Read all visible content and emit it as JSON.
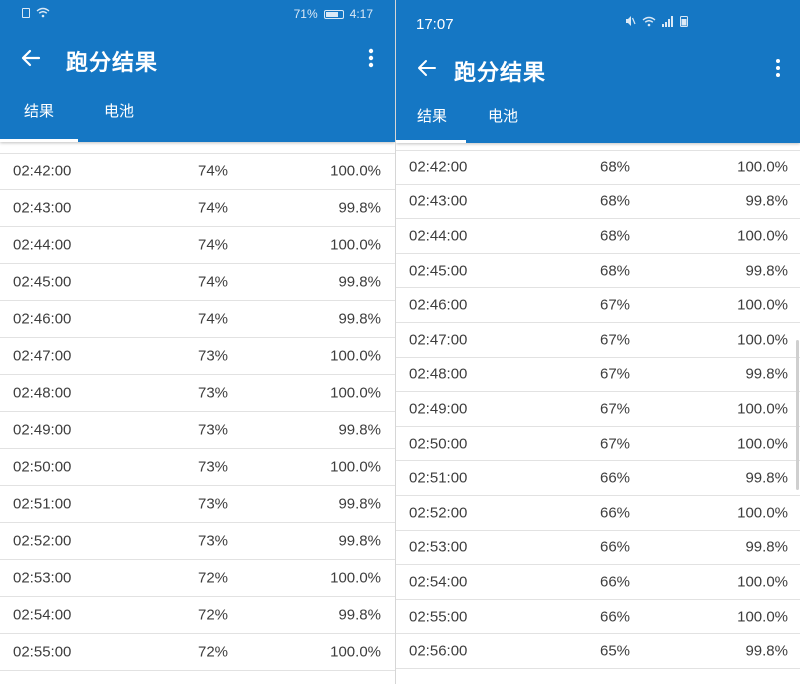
{
  "left": {
    "status": {
      "battery_percent": "71%",
      "time": "4:17"
    },
    "title": "跑分结果",
    "tabs": [
      {
        "label": "结果"
      },
      {
        "label": "电池"
      }
    ],
    "rows": [
      {
        "time": "02:42:00",
        "battery": "74%",
        "score": "100.0%"
      },
      {
        "time": "02:43:00",
        "battery": "74%",
        "score": "99.8%"
      },
      {
        "time": "02:44:00",
        "battery": "74%",
        "score": "100.0%"
      },
      {
        "time": "02:45:00",
        "battery": "74%",
        "score": "99.8%"
      },
      {
        "time": "02:46:00",
        "battery": "74%",
        "score": "99.8%"
      },
      {
        "time": "02:47:00",
        "battery": "73%",
        "score": "100.0%"
      },
      {
        "time": "02:48:00",
        "battery": "73%",
        "score": "100.0%"
      },
      {
        "time": "02:49:00",
        "battery": "73%",
        "score": "99.8%"
      },
      {
        "time": "02:50:00",
        "battery": "73%",
        "score": "100.0%"
      },
      {
        "time": "02:51:00",
        "battery": "73%",
        "score": "99.8%"
      },
      {
        "time": "02:52:00",
        "battery": "73%",
        "score": "99.8%"
      },
      {
        "time": "02:53:00",
        "battery": "72%",
        "score": "100.0%"
      },
      {
        "time": "02:54:00",
        "battery": "72%",
        "score": "99.8%"
      },
      {
        "time": "02:55:00",
        "battery": "72%",
        "score": "100.0%"
      }
    ]
  },
  "right": {
    "status": {
      "time": "17:07"
    },
    "title": "跑分结果",
    "tabs": [
      {
        "label": "结果"
      },
      {
        "label": "电池"
      }
    ],
    "rows": [
      {
        "time": "02:42:00",
        "battery": "68%",
        "score": "100.0%"
      },
      {
        "time": "02:43:00",
        "battery": "68%",
        "score": "99.8%"
      },
      {
        "time": "02:44:00",
        "battery": "68%",
        "score": "100.0%"
      },
      {
        "time": "02:45:00",
        "battery": "68%",
        "score": "99.8%"
      },
      {
        "time": "02:46:00",
        "battery": "67%",
        "score": "100.0%"
      },
      {
        "time": "02:47:00",
        "battery": "67%",
        "score": "100.0%"
      },
      {
        "time": "02:48:00",
        "battery": "67%",
        "score": "99.8%"
      },
      {
        "time": "02:49:00",
        "battery": "67%",
        "score": "100.0%"
      },
      {
        "time": "02:50:00",
        "battery": "67%",
        "score": "100.0%"
      },
      {
        "time": "02:51:00",
        "battery": "66%",
        "score": "99.8%"
      },
      {
        "time": "02:52:00",
        "battery": "66%",
        "score": "100.0%"
      },
      {
        "time": "02:53:00",
        "battery": "66%",
        "score": "99.8%"
      },
      {
        "time": "02:54:00",
        "battery": "66%",
        "score": "100.0%"
      },
      {
        "time": "02:55:00",
        "battery": "66%",
        "score": "100.0%"
      },
      {
        "time": "02:56:00",
        "battery": "65%",
        "score": "99.8%"
      }
    ]
  },
  "colors": {
    "appbar": "#1577c4",
    "text": "#3d3d3d",
    "divider": "#e2e2e2"
  },
  "icons": {
    "back": "arrow-left-icon",
    "more": "more-vert-icon",
    "wifi": "wifi-icon",
    "battery": "battery-icon"
  }
}
